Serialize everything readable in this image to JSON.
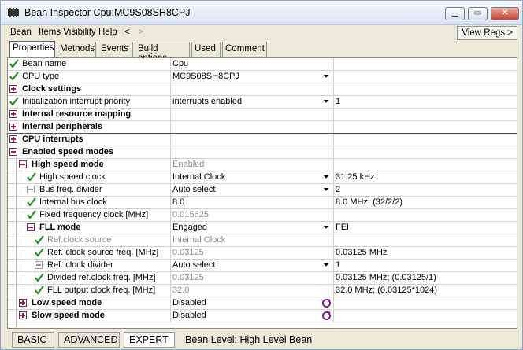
{
  "title": "Bean Inspector Cpu:MC9S08SH8CPJ",
  "menu": [
    "Bean",
    "Items Visibility",
    "Help",
    "<",
    ">"
  ],
  "view_regs": "View Regs >",
  "tabs": [
    "Properties",
    "Methods",
    "Events",
    "Build options",
    "Used",
    "Comment"
  ],
  "rows": [
    {
      "name": "Bean name",
      "value": "Cpu",
      "info": ""
    },
    {
      "name": "CPU type",
      "value": "MC9S08SH8CPJ",
      "info": ""
    },
    {
      "name": "Clock settings",
      "value": "",
      "info": ""
    },
    {
      "name": "Initialization interrupt priority",
      "value": "interrupts enabled",
      "info": "1"
    },
    {
      "name": "Internal resource mapping",
      "value": "",
      "info": ""
    },
    {
      "name": "Internal peripherals",
      "value": "",
      "info": ""
    },
    {
      "name": "CPU interrupts",
      "value": "",
      "info": ""
    },
    {
      "name": "Enabled speed modes",
      "value": "",
      "info": ""
    },
    {
      "name": "High speed mode",
      "value": "Enabled",
      "info": ""
    },
    {
      "name": "High speed clock",
      "value": "Internal Clock",
      "info": "31.25 kHz"
    },
    {
      "name": "Bus freq. divider",
      "value": "Auto select",
      "info": "2"
    },
    {
      "name": "Internal bus clock",
      "value": "8.0",
      "info": "8.0 MHz; (32/2/2)"
    },
    {
      "name": "Fixed frequency clock [MHz]",
      "value": "0.015625",
      "info": ""
    },
    {
      "name": "FLL mode",
      "value": "Engaged",
      "info": "FEI"
    },
    {
      "name": "Ref.clock source",
      "value": "Internal Clock",
      "info": ""
    },
    {
      "name": "Ref. clock source freq. [MHz]",
      "value": "0.03125",
      "info": "0.03125 MHz"
    },
    {
      "name": "Ref. clock divider",
      "value": "Auto select",
      "info": "1"
    },
    {
      "name": "Divided ref.clock freq. [MHz]",
      "value": "0.03125",
      "info": "0.03125 MHz; (0.03125/1)"
    },
    {
      "name": "FLL output clock freq. [MHz]",
      "value": "32.0",
      "info": "32.0 MHz; (0.03125*1024)"
    },
    {
      "name": "Low speed mode",
      "value": "Disabled",
      "info": ""
    },
    {
      "name": "Slow speed mode",
      "value": "Disabled",
      "info": ""
    }
  ],
  "status": {
    "tabs": [
      "BASIC",
      "ADVANCED",
      "EXPERT"
    ],
    "label": "Bean Level: High Level Bean"
  },
  "colors": {
    "check": "#1a8a1a",
    "expander": "#7a2a5a",
    "refresh": "#8a1a8a"
  }
}
